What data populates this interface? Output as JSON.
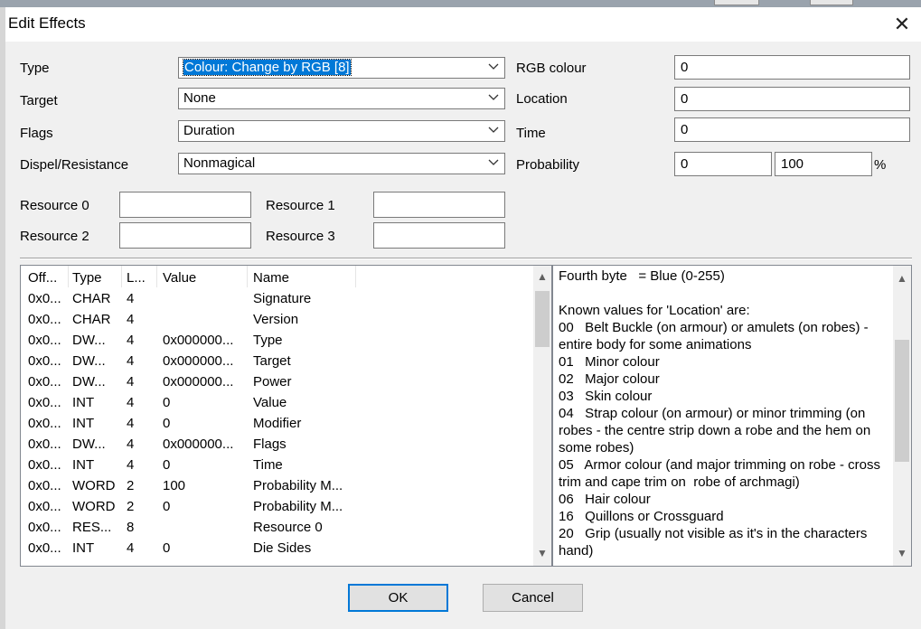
{
  "dialog": {
    "title": "Edit Effects",
    "close_glyph": "✕"
  },
  "form": {
    "type": {
      "label": "Type",
      "value": "Colour: Change by RGB [8]"
    },
    "target": {
      "label": "Target",
      "value": "None"
    },
    "flags": {
      "label": "Flags",
      "value": "Duration"
    },
    "dispel": {
      "label": "Dispel/Resistance",
      "value": "Nonmagical"
    },
    "rgb_colour": {
      "label": "RGB colour",
      "value": "0"
    },
    "location": {
      "label": "Location",
      "value": "0"
    },
    "time": {
      "label": "Time",
      "value": "0"
    },
    "probability": {
      "label": "Probability",
      "value1": "0",
      "value2": "100",
      "unit": "%"
    },
    "resource0": {
      "label": "Resource 0",
      "value": ""
    },
    "resource1": {
      "label": "Resource 1",
      "value": ""
    },
    "resource2": {
      "label": "Resource 2",
      "value": ""
    },
    "resource3": {
      "label": "Resource 3",
      "value": ""
    }
  },
  "listview": {
    "columns": [
      "Off...",
      "Type",
      "L...",
      "Value",
      "Name"
    ],
    "rows": [
      {
        "offset": "0x0...",
        "type": "CHAR",
        "len": "4",
        "value": "",
        "name": "Signature"
      },
      {
        "offset": "0x0...",
        "type": "CHAR",
        "len": "4",
        "value": "",
        "name": "Version"
      },
      {
        "offset": "0x0...",
        "type": "DW...",
        "len": "4",
        "value": "0x000000...",
        "name": "Type"
      },
      {
        "offset": "0x0...",
        "type": "DW...",
        "len": "4",
        "value": "0x000000...",
        "name": "Target"
      },
      {
        "offset": "0x0...",
        "type": "DW...",
        "len": "4",
        "value": "0x000000...",
        "name": "Power"
      },
      {
        "offset": "0x0...",
        "type": "INT",
        "len": "4",
        "value": "0",
        "name": "Value"
      },
      {
        "offset": "0x0...",
        "type": "INT",
        "len": "4",
        "value": "0",
        "name": "Modifier"
      },
      {
        "offset": "0x0...",
        "type": "DW...",
        "len": "4",
        "value": "0x000000...",
        "name": "Flags"
      },
      {
        "offset": "0x0...",
        "type": "INT",
        "len": "4",
        "value": "0",
        "name": "Time"
      },
      {
        "offset": "0x0...",
        "type": "WORD",
        "len": "2",
        "value": "100",
        "name": "Probability M..."
      },
      {
        "offset": "0x0...",
        "type": "WORD",
        "len": "2",
        "value": "0",
        "name": "Probability M..."
      },
      {
        "offset": "0x0...",
        "type": "RES...",
        "len": "8",
        "value": "",
        "name": "Resource 0"
      },
      {
        "offset": "0x0...",
        "type": "INT",
        "len": "4",
        "value": "0",
        "name": "Die Sides"
      }
    ]
  },
  "description": {
    "text": "Fourth byte   = Blue (0-255)\n\nKnown values for 'Location' are:\n00   Belt Buckle (on armour) or amulets (on robes) - entire body for some animations\n01   Minor colour\n02   Major colour\n03   Skin colour\n04   Strap colour (on armour) or minor trimming (on robes - the centre strip down a robe and the hem on some robes)\n05   Armor colour (and major trimming on robe - cross trim and cape trim on  robe of archmagi)\n06   Hair colour\n16   Quillons or Crossguard\n20   Grip (usually not visible as it's in the characters hand)"
  },
  "buttons": {
    "ok": "OK",
    "cancel": "Cancel"
  },
  "scroll_glyphs": {
    "up": "▲",
    "down": "▼"
  }
}
